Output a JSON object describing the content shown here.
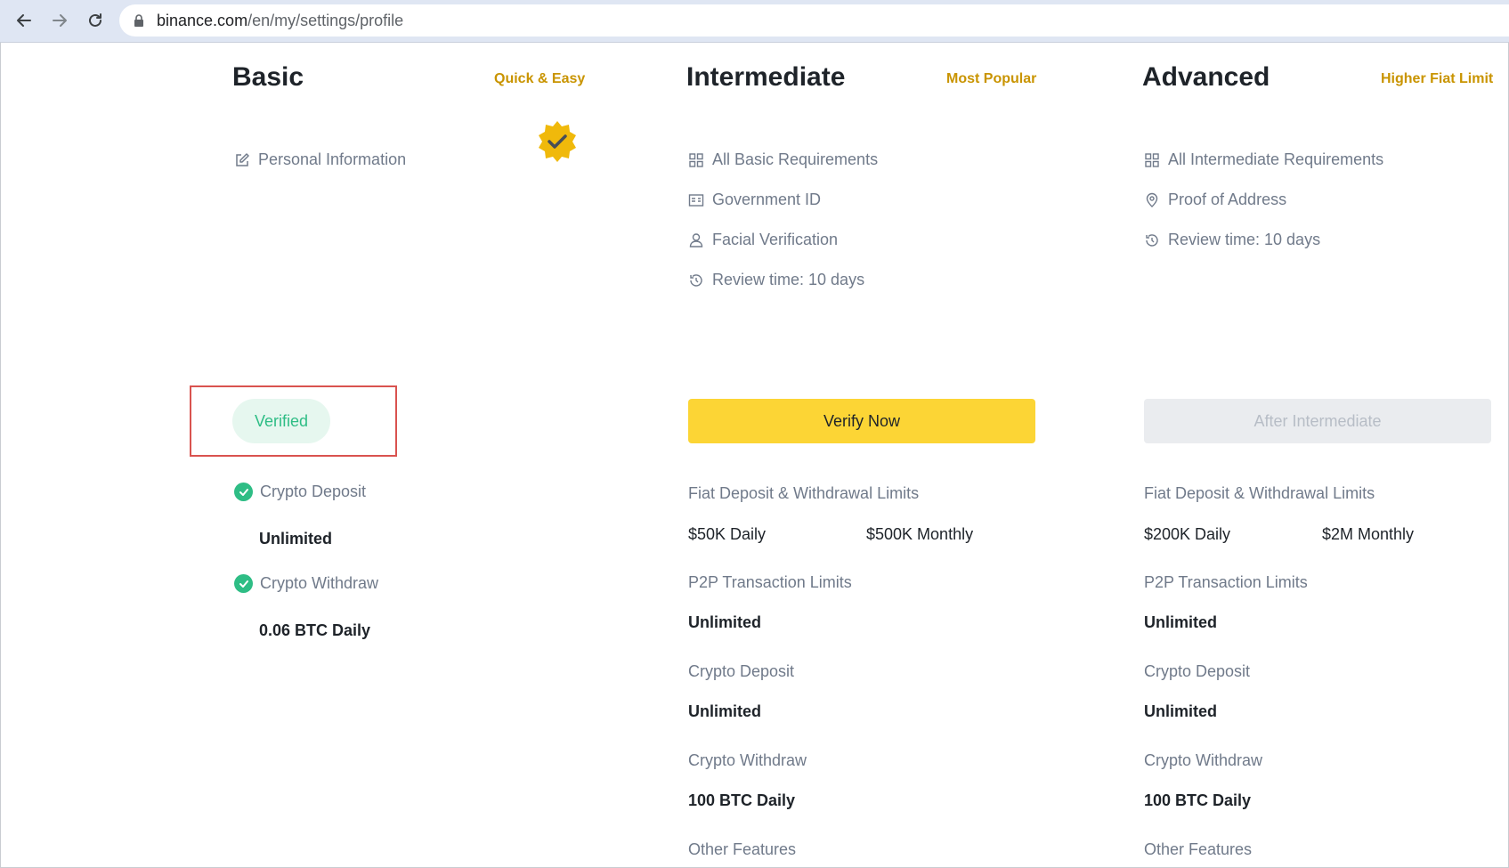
{
  "browser": {
    "url_host": "binance.com",
    "url_path": "/en/my/settings/profile"
  },
  "basic": {
    "title": "Basic",
    "tag": "Quick & Easy",
    "requirements": [
      "Personal Information"
    ],
    "status": "Verified",
    "features": [
      {
        "label": "Crypto Deposit",
        "value": "Unlimited"
      },
      {
        "label": "Crypto Withdraw",
        "value": "0.06 BTC Daily"
      }
    ]
  },
  "intermediate": {
    "title": "Intermediate",
    "tag": "Most Popular",
    "requirements": [
      "All Basic Requirements",
      "Government ID",
      "Facial Verification",
      "Review time: 10 days"
    ],
    "button": "Verify Now",
    "fiat_label": "Fiat Deposit & Withdrawal Limits",
    "fiat_daily": "$50K Daily",
    "fiat_monthly": "$500K Monthly",
    "p2p_label": "P2P Transaction Limits",
    "p2p_value": "Unlimited",
    "deposit_label": "Crypto Deposit",
    "deposit_value": "Unlimited",
    "withdraw_label": "Crypto Withdraw",
    "withdraw_value": "100 BTC Daily",
    "other_label": "Other Features"
  },
  "advanced": {
    "title": "Advanced",
    "tag": "Higher Fiat Limit",
    "requirements": [
      "All Intermediate Requirements",
      "Proof of Address",
      "Review time: 10 days"
    ],
    "button": "After Intermediate",
    "fiat_label": "Fiat Deposit & Withdrawal Limits",
    "fiat_daily": "$200K Daily",
    "fiat_monthly": "$2M Monthly",
    "p2p_label": "P2P Transaction Limits",
    "p2p_value": "Unlimited",
    "deposit_label": "Crypto Deposit",
    "deposit_value": "Unlimited",
    "withdraw_label": "Crypto Withdraw",
    "withdraw_value": "100 BTC Daily",
    "other_label": "Other Features"
  },
  "colors": {
    "accent": "#fcd535",
    "tag": "#c99400",
    "success": "#2ebd85",
    "highlight": "#d9534f"
  }
}
